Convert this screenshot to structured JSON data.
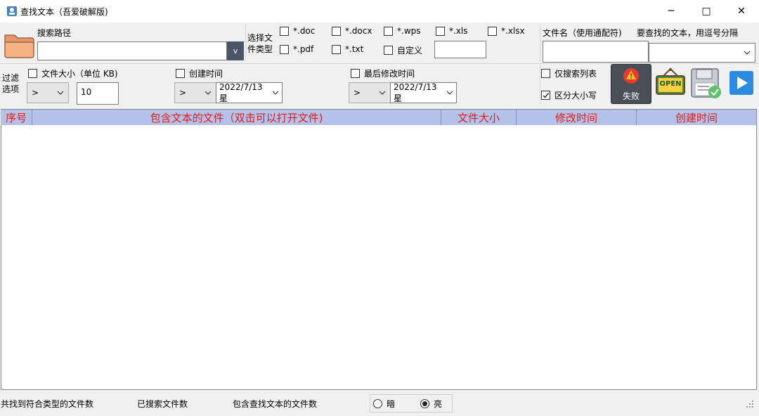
{
  "window": {
    "title": "查找文本（吾爱破解版)",
    "minimize": "─",
    "maximize": "□",
    "close": "✕"
  },
  "search_path": {
    "label": "搜索路径",
    "value": "",
    "dropdown_glyph": "v"
  },
  "file_types": {
    "label": "选择文件类型",
    "label_line1": "选择文",
    "label_line2": "件类型",
    "items": [
      {
        "label": "*.doc",
        "checked": false
      },
      {
        "label": "*.docx",
        "checked": false
      },
      {
        "label": "*.wps",
        "checked": false
      },
      {
        "label": "*.xls",
        "checked": false
      },
      {
        "label": "*.xlsx",
        "checked": false
      },
      {
        "label": "*.pdf",
        "checked": false
      },
      {
        "label": "*.txt",
        "checked": false
      },
      {
        "label": "自定义",
        "checked": false
      }
    ],
    "custom_value": ""
  },
  "filename_filter": {
    "label": "文件名（使用通配符)",
    "value": ""
  },
  "search_text": {
    "label": "要查找的文本，用逗号分隔",
    "value": ""
  },
  "filter": {
    "label_line1": "过滤",
    "label_line2": "选项",
    "size": {
      "label": "文件大小（单位 KB)",
      "op": ">",
      "value": "10"
    },
    "created": {
      "label": "创建时间",
      "op": ">",
      "date": "2022/7/13 星"
    },
    "modified": {
      "label": "最后修改时间",
      "op": ">",
      "date": "2022/7/13 星"
    }
  },
  "options": {
    "search_list_only": "仅搜索列表",
    "case_sensitive": "区分大小写",
    "case_checked": true
  },
  "buttons": {
    "status_label": "失败",
    "open_label": "OPEN"
  },
  "grid": {
    "columns": [
      "序号",
      "包含文本的文件（双击可以打开文件)",
      "文件大小",
      "修改时间",
      "创建时间"
    ]
  },
  "status": {
    "found_label": "共找到符合类型的文件数",
    "searched_label": "已搜索文件数",
    "matched_label": "包含查找文本的文件数",
    "theme_dark": "暗",
    "theme_light": "亮",
    "theme_selected": "亮"
  },
  "colors": {
    "header_bg": "#b4c1e8",
    "header_text": "#e31b1b",
    "play_blue": "#2b8be0"
  }
}
